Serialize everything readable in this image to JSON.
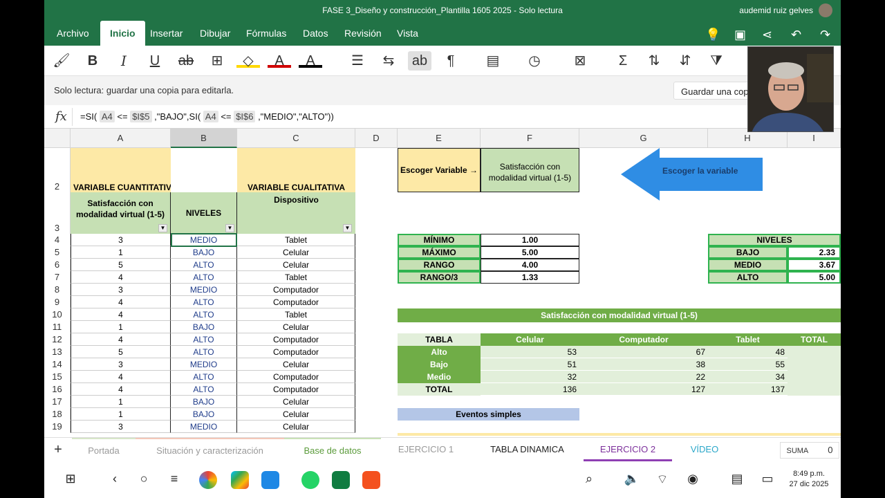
{
  "title": "FASE 3_Diseño y construcción_Plantilla 1605 2025 - Solo lectura",
  "user": "audemid ruiz gelves",
  "menu": {
    "tabs": [
      "Archivo",
      "Inicio",
      "Insertar",
      "Dibujar",
      "Fórmulas",
      "Datos",
      "Revisión",
      "Vista"
    ],
    "active": "Inicio"
  },
  "readonly": {
    "message": "Solo lectura: guardar una copia para editarla.",
    "save_button": "Guardar una copia"
  },
  "formula": {
    "fx": "fx",
    "p1": "=SI(",
    "r1": "A4",
    "p2": "<=",
    "r2": "$I$5",
    "p3": ",\"BAJO\",SI(",
    "r3": "A4",
    "p4": "<=",
    "r4": "$I$6",
    "p5": ",\"MEDIO\",\"ALTO\"))"
  },
  "columns": [
    "A",
    "B",
    "C",
    "D",
    "E",
    "F",
    "G",
    "H",
    "I"
  ],
  "headers": {
    "var_cuant": "VARIABLE CUANTITATIVA",
    "var_cual": "VARIABLE CUALITATIVA",
    "a3": "Satisfacción con modalidad virtual (1-5)",
    "b3": "NIVELES",
    "c3": "Dispositivo",
    "e2": "Escoger Variable →",
    "f2": "Satisfacción con modalidad virtual (1-5)",
    "arrow": "Escoger la variable"
  },
  "row_numbers": [
    "2",
    "3",
    "4",
    "5",
    "6",
    "7",
    "8",
    "9",
    "10",
    "11",
    "12",
    "13",
    "14",
    "15",
    "16",
    "17",
    "18",
    "19"
  ],
  "data_rows": [
    {
      "a": "3",
      "b": "MEDIO",
      "c": "Tablet"
    },
    {
      "a": "1",
      "b": "BAJO",
      "c": "Celular"
    },
    {
      "a": "5",
      "b": "ALTO",
      "c": "Celular"
    },
    {
      "a": "4",
      "b": "ALTO",
      "c": "Tablet"
    },
    {
      "a": "3",
      "b": "MEDIO",
      "c": "Computador"
    },
    {
      "a": "4",
      "b": "ALTO",
      "c": "Computador"
    },
    {
      "a": "4",
      "b": "ALTO",
      "c": "Tablet"
    },
    {
      "a": "1",
      "b": "BAJO",
      "c": "Celular"
    },
    {
      "a": "4",
      "b": "ALTO",
      "c": "Computador"
    },
    {
      "a": "5",
      "b": "ALTO",
      "c": "Computador"
    },
    {
      "a": "3",
      "b": "MEDIO",
      "c": "Celular"
    },
    {
      "a": "4",
      "b": "ALTO",
      "c": "Computador"
    },
    {
      "a": "4",
      "b": "ALTO",
      "c": "Computador"
    },
    {
      "a": "1",
      "b": "BAJO",
      "c": "Celular"
    },
    {
      "a": "1",
      "b": "BAJO",
      "c": "Celular"
    },
    {
      "a": "3",
      "b": "MEDIO",
      "c": "Celular"
    }
  ],
  "stats": [
    {
      "label": "MÍNIMO",
      "value": "1.00"
    },
    {
      "label": "MÁXIMO",
      "value": "5.00"
    },
    {
      "label": "RANGO",
      "value": "4.00"
    },
    {
      "label": "RANGO/3",
      "value": "1.33"
    }
  ],
  "niveles": {
    "title": "NIVELES",
    "rows": [
      {
        "label": "BAJO",
        "value": "2.33"
      },
      {
        "label": "MEDIO",
        "value": "3.67"
      },
      {
        "label": "ALTO",
        "value": "5.00"
      }
    ]
  },
  "pivot": {
    "banner": "Satisfacción con modalidad virtual (1-5)",
    "corner": "TABLA",
    "cols": [
      "Celular",
      "Computador",
      "Tablet",
      "TOTAL"
    ],
    "rows": [
      {
        "label": "Alto",
        "vals": [
          "53",
          "67",
          "48"
        ]
      },
      {
        "label": "Bajo",
        "vals": [
          "51",
          "38",
          "55"
        ]
      },
      {
        "label": "Medio",
        "vals": [
          "32",
          "22",
          "34"
        ]
      },
      {
        "label": "TOTAL",
        "vals": [
          "136",
          "127",
          "137"
        ]
      }
    ]
  },
  "eventos": "Eventos simples",
  "sheets": [
    "Portada",
    "Situación y caracterización",
    "Base de datos",
    "EJERCICIO 1",
    "TABLA DINAMICA",
    "EJERCICIO 2",
    "VÍDEO"
  ],
  "active_sheet": "EJERCICIO 2",
  "suma": {
    "label": "SUMA",
    "value": "0"
  },
  "clock": {
    "time": "8:49 p.m.",
    "date": "27 dic 2025"
  }
}
